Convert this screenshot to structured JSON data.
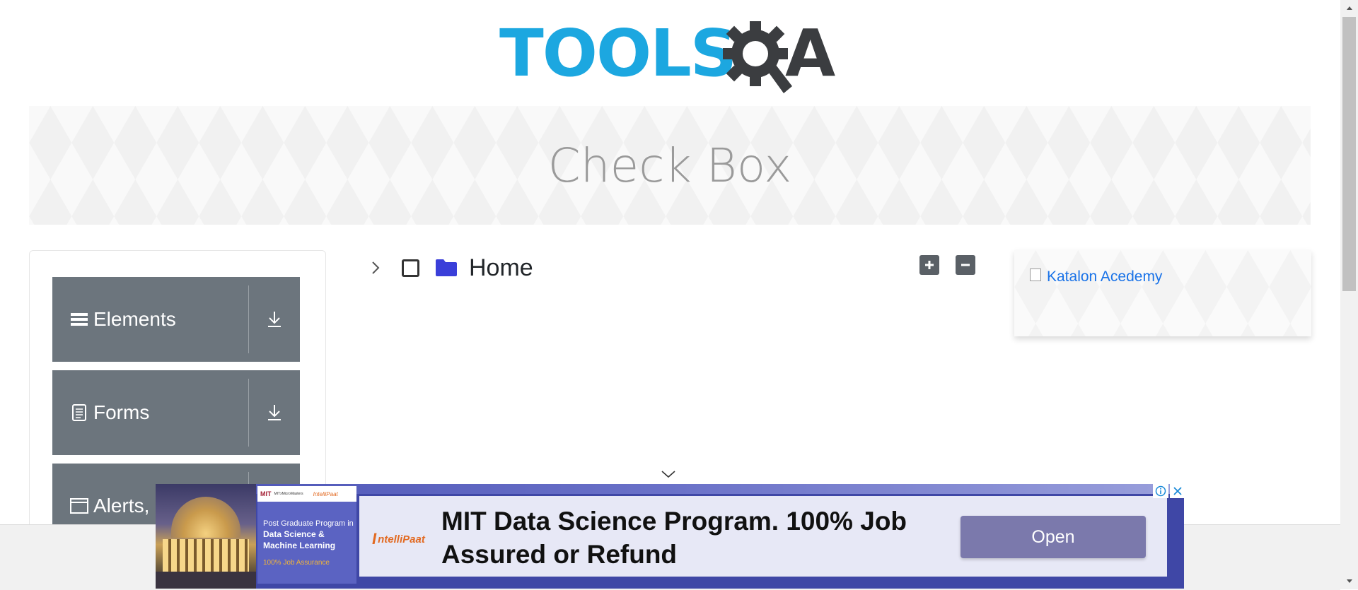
{
  "header": {
    "logo_text": "TOOLS",
    "logo_letter_a": "A"
  },
  "banner": {
    "title": "Check Box"
  },
  "sidebar": {
    "groups": [
      {
        "label": "Elements",
        "icon": "menu-icon"
      },
      {
        "label": "Forms",
        "icon": "document-icon"
      },
      {
        "label": "Alerts,",
        "icon": "window-icon"
      }
    ]
  },
  "tree": {
    "items": [
      {
        "label": "Home",
        "checked": false,
        "expanded": false
      }
    ],
    "expand_all_icon": "plus-icon",
    "collapse_all_icon": "minus-icon"
  },
  "right_ad": {
    "image_alt": "Katalon Acedemy"
  },
  "ad": {
    "card_brand_mit": "MIT",
    "card_brand_mit_sub": "MITxMicroMasters",
    "card_brand_ip": "IntelliPaat",
    "card_line1": "Post Graduate Program in",
    "card_line2": "Data Science &",
    "card_line3": "Machine Learning",
    "card_sub": "100% Job Assurance",
    "brand_mark": "I",
    "brand_text": "ntelliPaat",
    "headline": "MIT Data Science Program. 100% Job Assured or Refund",
    "cta": "Open"
  },
  "colors": {
    "accent": "#1ca7e0",
    "sidebar_group": "#6c757d",
    "folder": "#3a3fd9",
    "ad_bg": "#3f47a6",
    "ad_button": "#7b79ac"
  }
}
